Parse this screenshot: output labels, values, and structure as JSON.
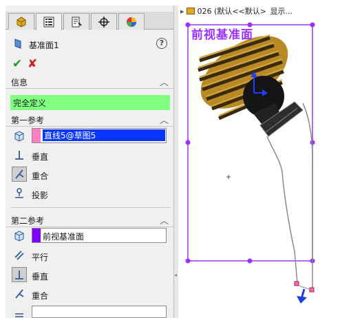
{
  "tabs": [
    {
      "name": "feature-manager"
    },
    {
      "name": "property-manager"
    },
    {
      "name": "configuration-manager"
    },
    {
      "name": "dimxpert-manager"
    },
    {
      "name": "display-manager"
    }
  ],
  "property_manager": {
    "title": "基准面1",
    "help": "?",
    "ok_icon": "✔",
    "cancel_icon": "✘"
  },
  "info": {
    "header": "信息",
    "status": "完全定义",
    "status_color": "#80ff80"
  },
  "first_ref": {
    "header": "第一参考",
    "selection": "直线5@草图5",
    "swatch_color": "#ff80c0",
    "options": [
      "垂直",
      "重合",
      "投影"
    ]
  },
  "second_ref": {
    "header": "第二参考",
    "selection": "前视基准面",
    "swatch_color": "#8000ff",
    "options": [
      "平行",
      "垂直",
      "重合"
    ]
  },
  "graphics": {
    "breadcrumb": "026 (默认<<默认>_显示...",
    "plane_label": "前视基准面",
    "plane_color": "#9b30ff"
  }
}
